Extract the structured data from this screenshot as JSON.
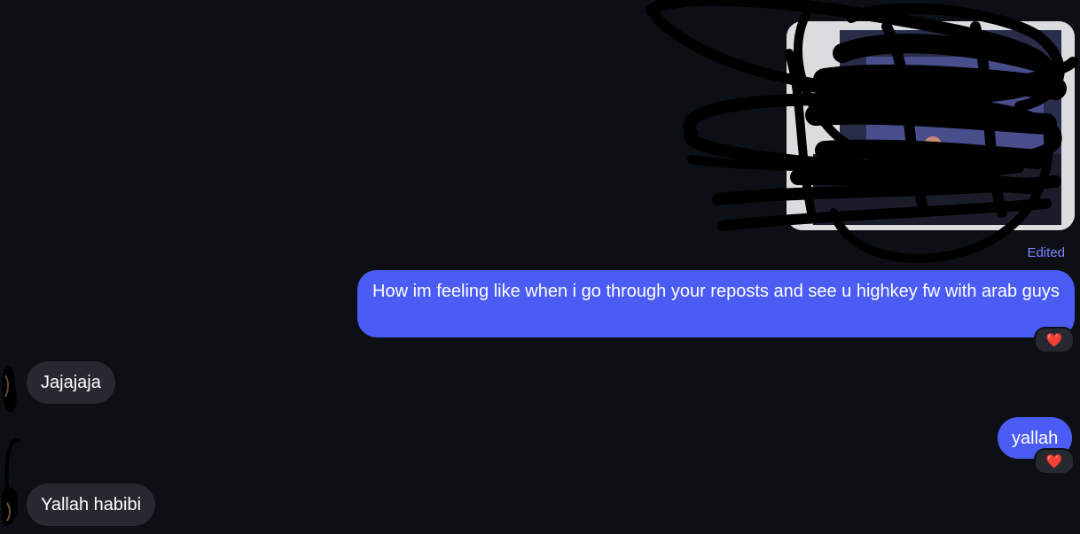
{
  "conversation": {
    "shared_image": {
      "alt": "Shared image (scribbled over)",
      "status": "Edited"
    },
    "messages": [
      {
        "sender": "me",
        "text": "How im feeling like when i go through your reposts and see u highkey fw with arab guys",
        "reaction": "❤️"
      },
      {
        "sender": "them",
        "text": "Jajajaja"
      },
      {
        "sender": "me",
        "text": "yallah",
        "reaction": "❤️"
      },
      {
        "sender": "them",
        "text": "Yallah habibi"
      }
    ]
  },
  "colors": {
    "background": "#0c1014",
    "sent_bubble": "#4a5cf3",
    "received_bubble": "#262a30",
    "edited_label": "#7d86ff",
    "heart": "#ff2d3d"
  },
  "icons": {
    "reaction": "heart-icon"
  }
}
